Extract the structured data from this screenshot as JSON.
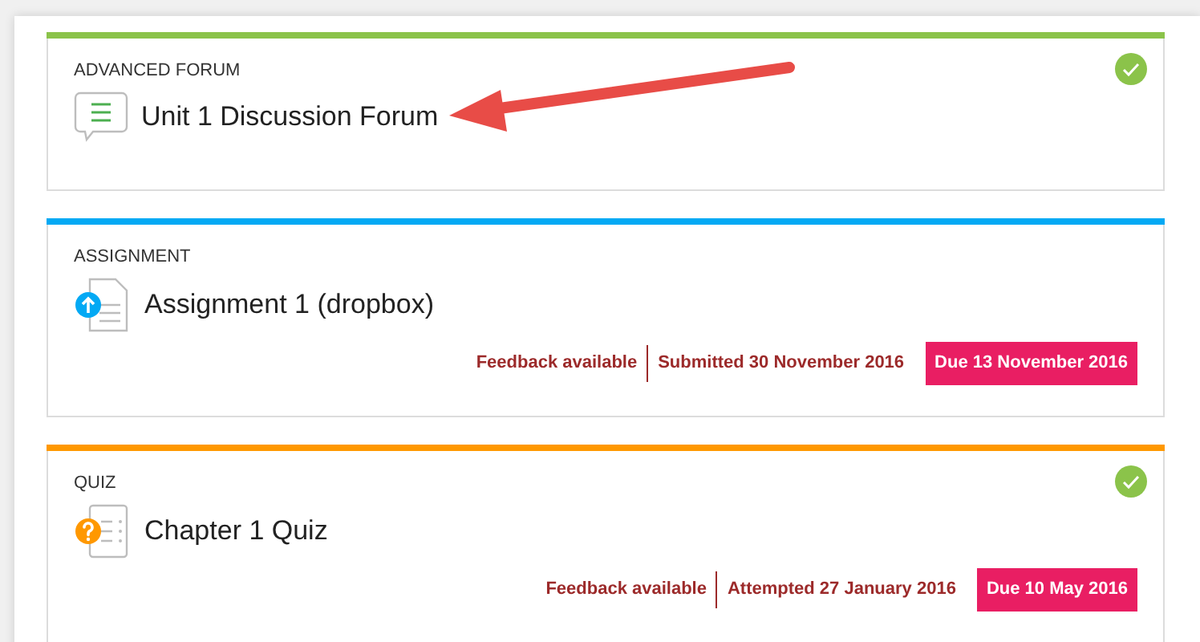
{
  "activities": [
    {
      "kind": "forum",
      "color": "#8bc34a",
      "type_label": "ADVANCED FORUM",
      "title": "Unit 1 Discussion Forum",
      "completed": true
    },
    {
      "kind": "assignment",
      "color": "#03a9f4",
      "type_label": "ASSIGNMENT",
      "title": "Assignment 1 (dropbox)",
      "completed": false,
      "meta": [
        {
          "kind": "info",
          "text": "Feedback available"
        },
        {
          "kind": "info",
          "text": "Submitted 30 November 2016"
        },
        {
          "kind": "due",
          "text": "Due 13 November 2016"
        }
      ]
    },
    {
      "kind": "quiz",
      "color": "#ff9800",
      "type_label": "QUIZ",
      "title": "Chapter 1 Quiz",
      "completed": true,
      "meta": [
        {
          "kind": "info",
          "text": "Feedback available"
        },
        {
          "kind": "info",
          "text": "Attempted 27 January 2016"
        },
        {
          "kind": "due",
          "text": "Due 10 May 2016"
        }
      ]
    }
  ]
}
